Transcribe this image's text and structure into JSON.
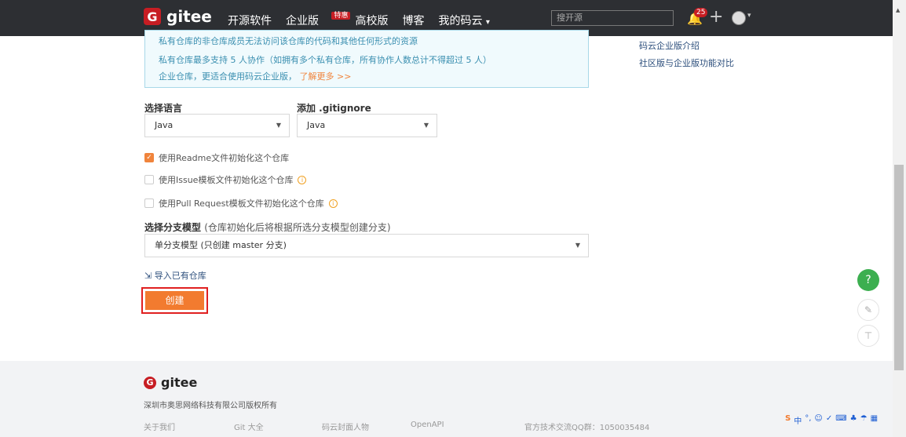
{
  "nav": {
    "logo_mark": "G",
    "logo_text": "gitee",
    "items": [
      "开源软件",
      "企业版",
      "高校版",
      "博客",
      "我的码云"
    ],
    "enterprise_badge": "特惠",
    "my_caret": "▾",
    "search_placeholder": "搜开源",
    "notification_count": "25",
    "plus": "+",
    "avatar_caret": "▾"
  },
  "info_box": {
    "line1": "私有仓库的非仓库成员无法访问该仓库的代码和其他任何形式的资源",
    "line2": "私有仓库最多支持 5 人协作（如拥有多个私有仓库，所有协作人数总计不得超过 5 人）",
    "line3": "企业仓库，更适合使用码云企业版，",
    "line3_link": "了解更多 >>"
  },
  "side_links": [
    "码云企业版介绍",
    "社区版与企业版功能对比"
  ],
  "form": {
    "language_label": "选择语言",
    "language_value": "Java",
    "gitignore_label": "添加 .gitignore",
    "gitignore_value": "Java",
    "caret": "▼",
    "checkboxes": [
      {
        "label": "使用Readme文件初始化这个仓库",
        "checked": true
      },
      {
        "label": "使用Issue模板文件初始化这个仓库",
        "checked": false
      },
      {
        "label": "使用Pull Request模板文件初始化这个仓库",
        "checked": false
      }
    ],
    "check_mark": "✓",
    "tip_glyph": "i",
    "branch_label": "选择分支模型",
    "branch_hint": "(仓库初始化后将根据所选分支模型创建分支)",
    "branch_value": "单分支模型 (只创建 master 分支)",
    "import_icon": "⇲",
    "import_link": "导入已有仓库",
    "create_button": "创建"
  },
  "floating": {
    "help": "?",
    "edit": "✎",
    "top": "⊤"
  },
  "footer": {
    "logo_mark": "G",
    "logo_text": "gitee",
    "copyright": "深圳市奥思网络科技有限公司版权所有",
    "links": [
      "关于我们",
      "Git 大全",
      "码云封面人物",
      "OpenAPI",
      "官方技术交流QQ群：1050035484"
    ]
  },
  "ime": {
    "mark": "S",
    "items": [
      "中",
      "°,",
      "☺",
      "✓",
      "⌨",
      "♣",
      "☂",
      "▦"
    ]
  },
  "scrollbar": {
    "up_arrow": "▲"
  }
}
